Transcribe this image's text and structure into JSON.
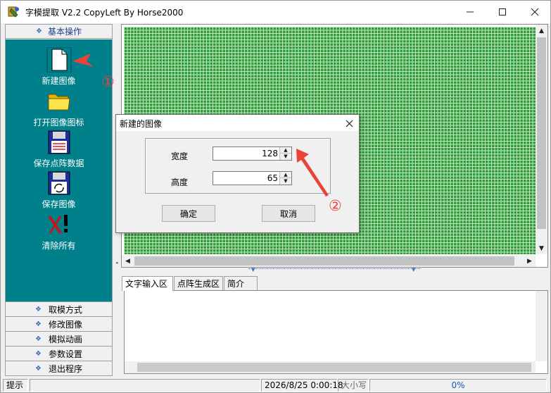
{
  "window": {
    "title": "字模提取 V2.2  CopyLeft By Horse2000",
    "icon": "app-icon",
    "controls": [
      "minimize-icon",
      "maximize-icon",
      "close-icon"
    ]
  },
  "sidebar": {
    "top_section": "基本操作",
    "tools": [
      {
        "label": "新建图像",
        "icon": "new-image-icon"
      },
      {
        "label": "打开图像图标",
        "icon": "open-folder-icon"
      },
      {
        "label": "保存点阵数据",
        "icon": "save-data-icon"
      },
      {
        "label": "保存图像",
        "icon": "save-image-icon"
      },
      {
        "label": "清除所有",
        "icon": "clear-all-icon"
      }
    ],
    "bottom_sections": [
      "取模方式",
      "修改图像",
      "模拟动画",
      "参数设置",
      "退出程序"
    ]
  },
  "tabs": [
    "文字输入区",
    "点阵生成区",
    "简介"
  ],
  "dialog": {
    "title": "新建的图像",
    "width_label": "宽度",
    "width_value": "128",
    "height_label": "高度",
    "height_value": "65",
    "ok_label": "确定",
    "cancel_label": "取消"
  },
  "statusbar": {
    "hint": "提示",
    "datetime": "2026/8/25 0:00:18",
    "caps": "大小写",
    "progress": "0%"
  },
  "annotations": {
    "marker_1": "①",
    "marker_2": "②",
    "arrow_color": "#e8443a"
  },
  "colors": {
    "sidebar_bg": "#00808a",
    "canvas_bg": "#2e9d39"
  }
}
